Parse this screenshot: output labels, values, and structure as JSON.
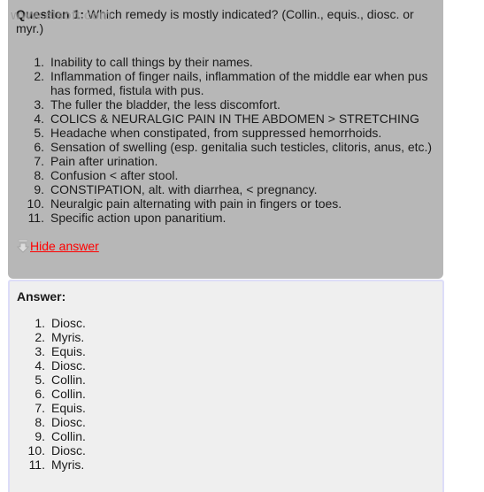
{
  "question": {
    "label": "Question 1:",
    "text": " Which remedy is mostly indicated? (Collin., equis., diosc. or myr.)",
    "watermark": "www.elsoft.com",
    "items": [
      {
        "num": "1.",
        "text": "Inability to call things by their names."
      },
      {
        "num": "2.",
        "text": "Inflammation of finger nails, inflammation of the middle ear when pus has formed, fistula with pus."
      },
      {
        "num": "3.",
        "text": "The fuller the bladder, the less discomfort."
      },
      {
        "num": "4.",
        "text": "COLICS & NEURALGIC PAIN IN THE ABDOMEN > STRETCHING"
      },
      {
        "num": "5.",
        "text": "Headache when constipated, from suppressed hemorrhoids."
      },
      {
        "num": "6.",
        "text": "Sensation of swelling (esp. genitalia such testicles, clitoris, anus, etc.)"
      },
      {
        "num": "7.",
        "text": "Pain after urination."
      },
      {
        "num": "8.",
        "text": "Confusion < after stool."
      },
      {
        "num": "9.",
        "text": "CONSTIPATION, alt. with diarrhea, < pregnancy."
      },
      {
        "num": "10.",
        "text": "Neuralgic pain alternating with pain in fingers or toes."
      },
      {
        "num": "11.",
        "text": "Specific action upon panaritium."
      }
    ],
    "hide_answer_label": "Hide answer",
    "hide_icon": "arrow-down-bar-icon"
  },
  "answer": {
    "heading": "Answer:",
    "items": [
      {
        "num": "1.",
        "text": "Diosc."
      },
      {
        "num": "2.",
        "text": "Myris."
      },
      {
        "num": "3.",
        "text": "Equis."
      },
      {
        "num": "4.",
        "text": "Diosc."
      },
      {
        "num": "5.",
        "text": "Collin."
      },
      {
        "num": "6.",
        "text": "Collin."
      },
      {
        "num": "7.",
        "text": "Equis."
      },
      {
        "num": "8.",
        "text": "Diosc."
      },
      {
        "num": "9.",
        "text": "Collin."
      },
      {
        "num": "10.",
        "text": "Diosc."
      },
      {
        "num": "11.",
        "text": "Myris."
      }
    ]
  },
  "colors": {
    "question_bg": "#b7b7b7",
    "answer_bg": "#efefef",
    "answer_border": "#ddddf8",
    "link": "#ff0000"
  }
}
